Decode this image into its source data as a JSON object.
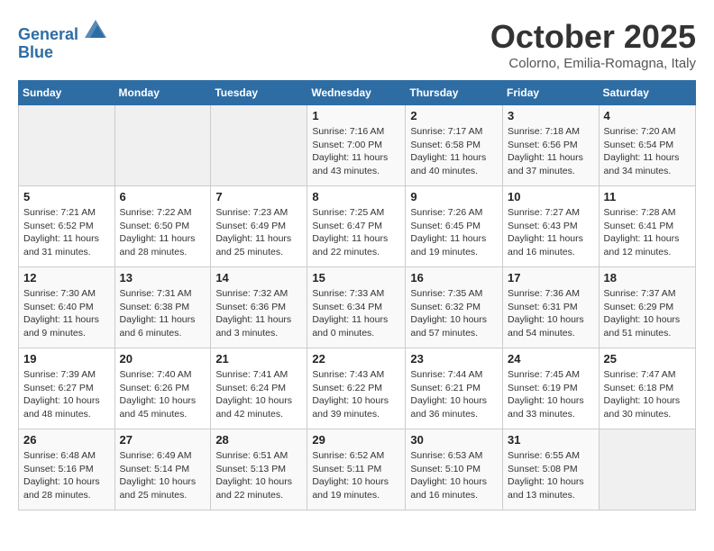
{
  "header": {
    "logo_line1": "General",
    "logo_line2": "Blue",
    "month_title": "October 2025",
    "location": "Colorno, Emilia-Romagna, Italy"
  },
  "days_of_week": [
    "Sunday",
    "Monday",
    "Tuesday",
    "Wednesday",
    "Thursday",
    "Friday",
    "Saturday"
  ],
  "weeks": [
    [
      {
        "day": "",
        "sunrise": "",
        "sunset": "",
        "daylight": ""
      },
      {
        "day": "",
        "sunrise": "",
        "sunset": "",
        "daylight": ""
      },
      {
        "day": "",
        "sunrise": "",
        "sunset": "",
        "daylight": ""
      },
      {
        "day": "1",
        "sunrise": "Sunrise: 7:16 AM",
        "sunset": "Sunset: 7:00 PM",
        "daylight": "Daylight: 11 hours and 43 minutes."
      },
      {
        "day": "2",
        "sunrise": "Sunrise: 7:17 AM",
        "sunset": "Sunset: 6:58 PM",
        "daylight": "Daylight: 11 hours and 40 minutes."
      },
      {
        "day": "3",
        "sunrise": "Sunrise: 7:18 AM",
        "sunset": "Sunset: 6:56 PM",
        "daylight": "Daylight: 11 hours and 37 minutes."
      },
      {
        "day": "4",
        "sunrise": "Sunrise: 7:20 AM",
        "sunset": "Sunset: 6:54 PM",
        "daylight": "Daylight: 11 hours and 34 minutes."
      }
    ],
    [
      {
        "day": "5",
        "sunrise": "Sunrise: 7:21 AM",
        "sunset": "Sunset: 6:52 PM",
        "daylight": "Daylight: 11 hours and 31 minutes."
      },
      {
        "day": "6",
        "sunrise": "Sunrise: 7:22 AM",
        "sunset": "Sunset: 6:50 PM",
        "daylight": "Daylight: 11 hours and 28 minutes."
      },
      {
        "day": "7",
        "sunrise": "Sunrise: 7:23 AM",
        "sunset": "Sunset: 6:49 PM",
        "daylight": "Daylight: 11 hours and 25 minutes."
      },
      {
        "day": "8",
        "sunrise": "Sunrise: 7:25 AM",
        "sunset": "Sunset: 6:47 PM",
        "daylight": "Daylight: 11 hours and 22 minutes."
      },
      {
        "day": "9",
        "sunrise": "Sunrise: 7:26 AM",
        "sunset": "Sunset: 6:45 PM",
        "daylight": "Daylight: 11 hours and 19 minutes."
      },
      {
        "day": "10",
        "sunrise": "Sunrise: 7:27 AM",
        "sunset": "Sunset: 6:43 PM",
        "daylight": "Daylight: 11 hours and 16 minutes."
      },
      {
        "day": "11",
        "sunrise": "Sunrise: 7:28 AM",
        "sunset": "Sunset: 6:41 PM",
        "daylight": "Daylight: 11 hours and 12 minutes."
      }
    ],
    [
      {
        "day": "12",
        "sunrise": "Sunrise: 7:30 AM",
        "sunset": "Sunset: 6:40 PM",
        "daylight": "Daylight: 11 hours and 9 minutes."
      },
      {
        "day": "13",
        "sunrise": "Sunrise: 7:31 AM",
        "sunset": "Sunset: 6:38 PM",
        "daylight": "Daylight: 11 hours and 6 minutes."
      },
      {
        "day": "14",
        "sunrise": "Sunrise: 7:32 AM",
        "sunset": "Sunset: 6:36 PM",
        "daylight": "Daylight: 11 hours and 3 minutes."
      },
      {
        "day": "15",
        "sunrise": "Sunrise: 7:33 AM",
        "sunset": "Sunset: 6:34 PM",
        "daylight": "Daylight: 11 hours and 0 minutes."
      },
      {
        "day": "16",
        "sunrise": "Sunrise: 7:35 AM",
        "sunset": "Sunset: 6:32 PM",
        "daylight": "Daylight: 10 hours and 57 minutes."
      },
      {
        "day": "17",
        "sunrise": "Sunrise: 7:36 AM",
        "sunset": "Sunset: 6:31 PM",
        "daylight": "Daylight: 10 hours and 54 minutes."
      },
      {
        "day": "18",
        "sunrise": "Sunrise: 7:37 AM",
        "sunset": "Sunset: 6:29 PM",
        "daylight": "Daylight: 10 hours and 51 minutes."
      }
    ],
    [
      {
        "day": "19",
        "sunrise": "Sunrise: 7:39 AM",
        "sunset": "Sunset: 6:27 PM",
        "daylight": "Daylight: 10 hours and 48 minutes."
      },
      {
        "day": "20",
        "sunrise": "Sunrise: 7:40 AM",
        "sunset": "Sunset: 6:26 PM",
        "daylight": "Daylight: 10 hours and 45 minutes."
      },
      {
        "day": "21",
        "sunrise": "Sunrise: 7:41 AM",
        "sunset": "Sunset: 6:24 PM",
        "daylight": "Daylight: 10 hours and 42 minutes."
      },
      {
        "day": "22",
        "sunrise": "Sunrise: 7:43 AM",
        "sunset": "Sunset: 6:22 PM",
        "daylight": "Daylight: 10 hours and 39 minutes."
      },
      {
        "day": "23",
        "sunrise": "Sunrise: 7:44 AM",
        "sunset": "Sunset: 6:21 PM",
        "daylight": "Daylight: 10 hours and 36 minutes."
      },
      {
        "day": "24",
        "sunrise": "Sunrise: 7:45 AM",
        "sunset": "Sunset: 6:19 PM",
        "daylight": "Daylight: 10 hours and 33 minutes."
      },
      {
        "day": "25",
        "sunrise": "Sunrise: 7:47 AM",
        "sunset": "Sunset: 6:18 PM",
        "daylight": "Daylight: 10 hours and 30 minutes."
      }
    ],
    [
      {
        "day": "26",
        "sunrise": "Sunrise: 6:48 AM",
        "sunset": "Sunset: 5:16 PM",
        "daylight": "Daylight: 10 hours and 28 minutes."
      },
      {
        "day": "27",
        "sunrise": "Sunrise: 6:49 AM",
        "sunset": "Sunset: 5:14 PM",
        "daylight": "Daylight: 10 hours and 25 minutes."
      },
      {
        "day": "28",
        "sunrise": "Sunrise: 6:51 AM",
        "sunset": "Sunset: 5:13 PM",
        "daylight": "Daylight: 10 hours and 22 minutes."
      },
      {
        "day": "29",
        "sunrise": "Sunrise: 6:52 AM",
        "sunset": "Sunset: 5:11 PM",
        "daylight": "Daylight: 10 hours and 19 minutes."
      },
      {
        "day": "30",
        "sunrise": "Sunrise: 6:53 AM",
        "sunset": "Sunset: 5:10 PM",
        "daylight": "Daylight: 10 hours and 16 minutes."
      },
      {
        "day": "31",
        "sunrise": "Sunrise: 6:55 AM",
        "sunset": "Sunset: 5:08 PM",
        "daylight": "Daylight: 10 hours and 13 minutes."
      },
      {
        "day": "",
        "sunrise": "",
        "sunset": "",
        "daylight": ""
      }
    ]
  ]
}
